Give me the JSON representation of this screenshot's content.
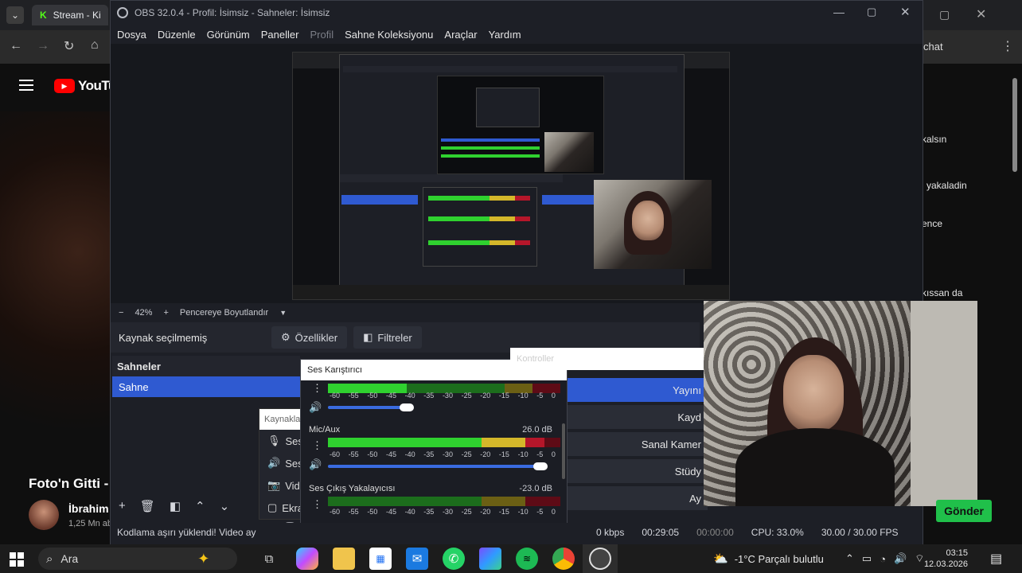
{
  "browser": {
    "tab_title": "Stream - Kick",
    "page_channel_label": "YouTube",
    "video_title": "Foto'n Gitti -",
    "channel_name": "İbrahim",
    "subscribers": "1,25 Mn ab"
  },
  "obs": {
    "title": "OBS 32.0.4 - Profil: İsimsiz - Sahneler: İsimsiz",
    "menu": [
      "Dosya",
      "Düzenle",
      "Görünüm",
      "Paneller",
      "Profil",
      "Sahne Koleksiyonu",
      "Araçlar",
      "Yardım"
    ],
    "zoom": "42%",
    "fit_label": "Pencereye Boyutlandır",
    "no_source": "Kaynak seçilmemiş",
    "properties": "Özellikler",
    "filters": "Filtreler",
    "scenes_title": "Sahneler",
    "scene_item": "Sahne",
    "sources_title": "Kaynakla",
    "source_rows": [
      "Ses",
      "Ses",
      "Vide",
      "Ekra"
    ],
    "mixer_title": "Ses Karıştırıcı",
    "mixer_scale": [
      "-60",
      "-55",
      "-50",
      "-45",
      "-40",
      "-35",
      "-30",
      "-25",
      "-20",
      "-15",
      "-10",
      "-5",
      "0"
    ],
    "channels": [
      {
        "name": "Mic/Aux",
        "db": "26.0 dB",
        "level": 0.93
      },
      {
        "name": "Ses Çıkış Yakalayıcısı",
        "db": "-23.0 dB",
        "level": 0.6
      }
    ],
    "desktop_level": 0.34,
    "controls_title": "Kontroller",
    "controls": [
      "Yayını",
      "Kayd",
      "Sanal Kamer",
      "Stüdy",
      "Ay"
    ],
    "status_warning": "Kodlama aşırı yüklendi! Video ay",
    "kbps": "0 kbps",
    "stream_time": "00:29:05",
    "rec_time": "00:00:00",
    "cpu": "CPU: 33.0%",
    "fps": "30.00 / 30.00 FPS"
  },
  "chat": {
    "header": "chat",
    "lines": [
      "kalsın",
      "i yakaladin",
      "ence",
      "kıssan da"
    ],
    "send": "Gönder"
  },
  "taskbar": {
    "search": "Ara",
    "weather": "-1°C  Parçalı bulutlu",
    "time": "03:15",
    "date": "12.03.2026"
  },
  "colors": {
    "accent_blue": "#2f5ad1",
    "meter_green": "#2fd12f",
    "meter_yellow": "#d4b72a",
    "meter_red": "#b5162a",
    "send_green": "#20c04a"
  }
}
